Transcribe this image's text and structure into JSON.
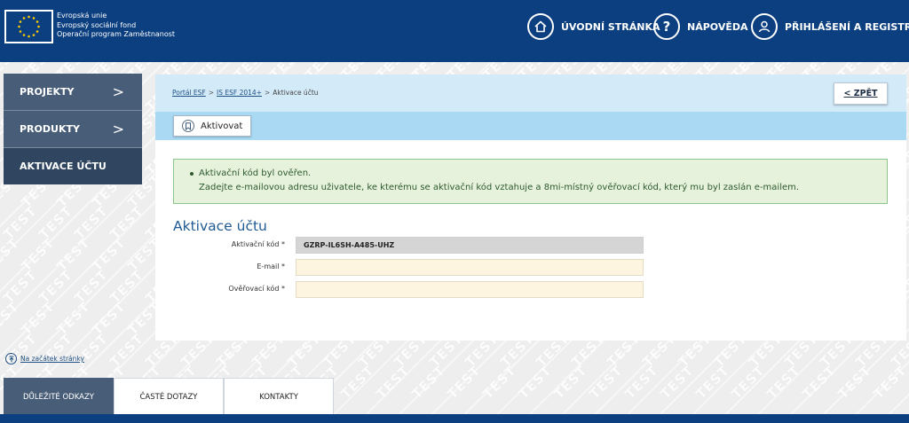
{
  "header": {
    "eu_lines": [
      "Evropská unie",
      "Evropský sociální fond",
      "Operační program Zaměstnanost"
    ],
    "nav": [
      {
        "label": "ÚVODNÍ STRÁNKA",
        "icon": "home-icon"
      },
      {
        "label": "NÁPOVĚDA",
        "icon": "help-icon"
      },
      {
        "label": "PŘIHLÁŠENÍ A REGISTRACE",
        "icon": "user-icon"
      }
    ]
  },
  "sidebar": {
    "items": [
      {
        "label": "PROJEKTY",
        "chevron": ">"
      },
      {
        "label": "PRODUKTY",
        "chevron": ">"
      },
      {
        "label": "AKTIVACE ÚČTU"
      }
    ]
  },
  "breadcrumb": {
    "items": [
      "Portál ESF",
      "IS ESF 2014+",
      "Aktivace účtu"
    ],
    "separator": ">"
  },
  "back_button": "< ZPĚT",
  "action_button": "Aktivovat",
  "message": {
    "line1": "Aktivační kód byl ověřen.",
    "line2": "Zadejte e-mailovou adresu uživatele, ke kterému se aktivační kód vztahuje a 8mi-místný ověřovací kód, který mu byl zaslán e-mailem."
  },
  "form": {
    "title": "Aktivace účtu",
    "fields": [
      {
        "label": "Aktivační kód *",
        "value": "GZRP-IL6SH-A485-UHZ",
        "readonly": true
      },
      {
        "label": "E-mail *",
        "value": ""
      },
      {
        "label": "Ověřovací kód *",
        "value": ""
      }
    ]
  },
  "to_top": "Na začátek stránky",
  "footer_tabs": [
    "DŮLEŽITÉ ODKAZY",
    "ČASTÉ DOTAZY",
    "KONTAKTY"
  ],
  "watermark": "TEST",
  "colors": {
    "header": "#0b3f7f",
    "sidebar": "#485e78",
    "crumb_bar": "#d3eaf8",
    "action_bar": "#a9d9f3",
    "success_bg": "#e6f2dc",
    "input_bg": "#fdf5e0"
  }
}
